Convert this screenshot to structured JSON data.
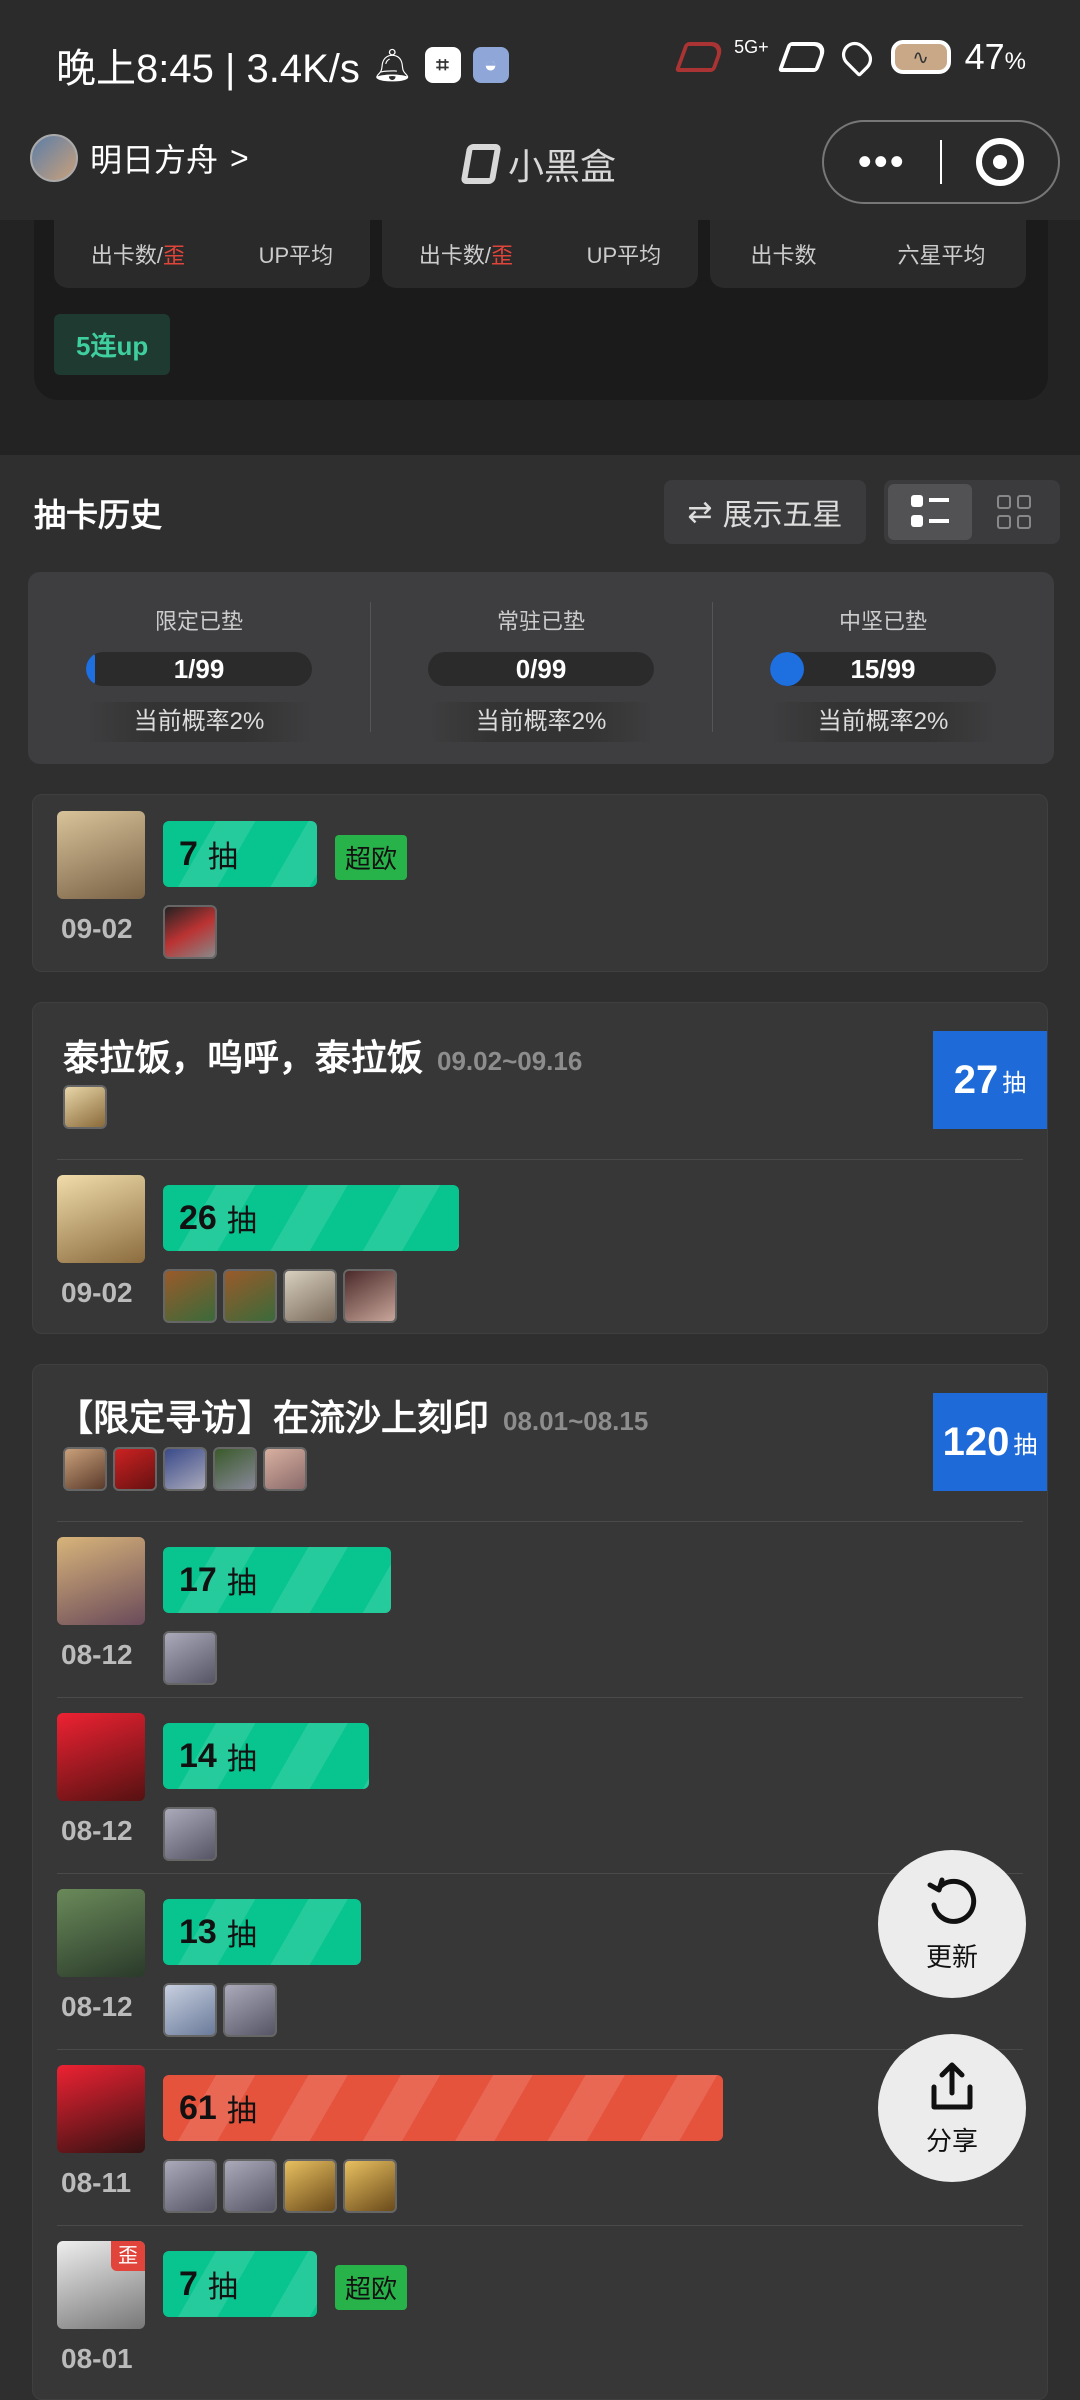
{
  "status_bar": {
    "time_speed": "晚上8:45 | 3.4K/s",
    "network": "5G+",
    "battery_pct": "47",
    "battery_unit": "%"
  },
  "nav": {
    "game_name": "明日方舟",
    "chevron": ">",
    "app_title": "小黑盒",
    "more": "•••"
  },
  "summary": {
    "boxes": [
      {
        "left": "出卡数",
        "slash": "/",
        "wai": "歪",
        "right": "UP平均"
      },
      {
        "left": "出卡数",
        "slash": "/",
        "wai": "歪",
        "right": "UP平均"
      },
      {
        "left": "出卡数",
        "slash": "",
        "wai": "",
        "right": "六星平均"
      }
    ],
    "tag": "5连up"
  },
  "history": {
    "title": "抽卡历史",
    "show_five_button": "展示五星"
  },
  "pity": [
    {
      "label": "限定已垫",
      "value": "1/99",
      "fill": 0.01,
      "rate": "当前概率2%"
    },
    {
      "label": "常驻已垫",
      "value": "0/99",
      "fill": 0.0,
      "rate": "当前概率2%"
    },
    {
      "label": "中坚已垫",
      "value": "15/99",
      "fill": 0.15,
      "rate": "当前概率2%"
    }
  ],
  "cards": {
    "first": {
      "pull": {
        "count": "7",
        "unit": "抽",
        "date": "09-02",
        "tag": "超欧"
      }
    },
    "pool1": {
      "name": "泰拉饭，呜呼，泰拉饭",
      "dates": "09.02~09.16",
      "total": "27",
      "total_unit": "抽",
      "pull": {
        "count": "26",
        "unit": "抽",
        "date": "09-02"
      }
    },
    "pool2": {
      "name": "【限定寻访】在流沙上刻印",
      "dates": "08.01~08.15",
      "total": "120",
      "total_unit": "抽",
      "pulls": [
        {
          "count": "17",
          "unit": "抽",
          "date": "08-12"
        },
        {
          "count": "14",
          "unit": "抽",
          "date": "08-12"
        },
        {
          "count": "13",
          "unit": "抽",
          "date": "08-12"
        },
        {
          "count": "61",
          "unit": "抽",
          "date": "08-11"
        },
        {
          "count": "7",
          "unit": "抽",
          "date": "08-01",
          "tag": "超欧",
          "wai": "歪"
        }
      ]
    }
  },
  "fabs": {
    "refresh": "更新",
    "share": "分享"
  },
  "colors": {
    "accent_green": "#08c48f",
    "accent_red": "#e5533d",
    "count_blue": "#1d6ad8"
  }
}
